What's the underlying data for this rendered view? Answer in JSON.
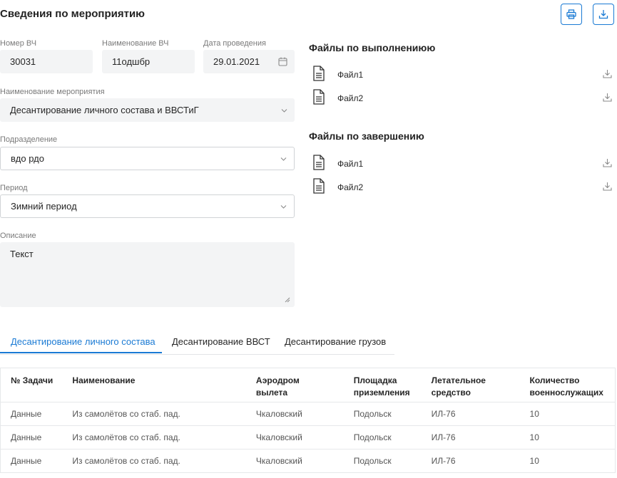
{
  "header": {
    "title": "Сведения по мероприятию",
    "print_icon": "printer-icon",
    "download_icon": "download-icon",
    "accent": "#1a7ad4"
  },
  "form": {
    "unit_number": {
      "label": "Номер ВЧ",
      "value": "30031"
    },
    "unit_name": {
      "label": "Наименование ВЧ",
      "value": "11одшбр"
    },
    "date": {
      "label": "Дата проведения",
      "value": "29.01.2021"
    },
    "event_name": {
      "label": "Наименование мероприятия",
      "value": "Десантирование личного состава и ВВСТиГ"
    },
    "subdivision": {
      "label": "Подразделение",
      "value": "вдо рдо"
    },
    "period": {
      "label": "Период",
      "value": "Зимний период"
    },
    "description": {
      "label": "Описание",
      "value": "Текст"
    }
  },
  "files_execution": {
    "title": "Файлы по выполнениюю",
    "items": [
      {
        "name": "Файл1"
      },
      {
        "name": "Файл2"
      }
    ]
  },
  "files_completion": {
    "title": "Файлы по завершению",
    "items": [
      {
        "name": "Файл1"
      },
      {
        "name": "Файл2"
      }
    ]
  },
  "tabs": [
    {
      "label": "Десантирование личного состава",
      "active": true
    },
    {
      "label": "Десантирование ВВСТ",
      "active": false
    },
    {
      "label": "Десантирование грузов",
      "active": false
    }
  ],
  "table": {
    "headers": {
      "task_no": "№ Задачи",
      "name": "Наименование",
      "airfield_l1": "Аэродром",
      "airfield_l2": "вылета",
      "landing_l1": "Площадка",
      "landing_l2": "приземления",
      "aircraft_l1": "Летательное",
      "aircraft_l2": "средство",
      "count_l1": "Количество",
      "count_l2": "военнослужащих"
    },
    "rows": [
      {
        "task_no": "Данные",
        "name": "Из самолётов со стаб. пад.",
        "airfield": "Чкаловский",
        "landing": "Подольск",
        "aircraft": "ИЛ-76",
        "count": "10"
      },
      {
        "task_no": "Данные",
        "name": "Из самолётов со стаб. пад.",
        "airfield": "Чкаловский",
        "landing": "Подольск",
        "aircraft": "ИЛ-76",
        "count": "10"
      },
      {
        "task_no": "Данные",
        "name": "Из самолётов со стаб. пад.",
        "airfield": "Чкаловский",
        "landing": "Подольск",
        "aircraft": "ИЛ-76",
        "count": "10"
      }
    ]
  }
}
